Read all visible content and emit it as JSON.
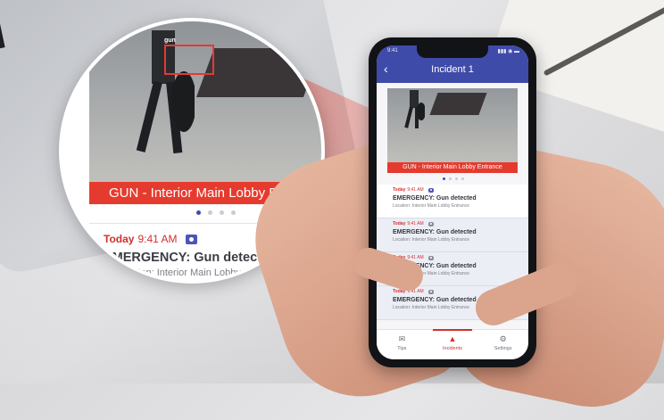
{
  "zoom": {
    "camera_label": "gun",
    "banner": "GUN - Interior Main Lobby Entrance",
    "carousel": {
      "count": 4,
      "active": 0
    },
    "alert": {
      "day": "Today",
      "time": "9:41 AM",
      "title": "EMERGENCY: Gun detected",
      "location": "Location: Interior Main Lobby Entrance"
    }
  },
  "phone": {
    "status_time": "9:41",
    "status_icons": "▮▮▮ ◉ ▬",
    "back_icon": "‹",
    "title": "Incident 1",
    "banner": "GUN - Interior Main Lobby Entrance",
    "carousel": {
      "count": 4,
      "active": 0
    },
    "alerts": [
      {
        "day": "Today",
        "time": "9:41 AM",
        "title": "EMERGENCY: Gun detected",
        "location": "Location: Interior Main Lobby Entrance",
        "icon": "camera-icon"
      },
      {
        "day": "Today",
        "time": "9:41 AM",
        "title": "EMERGENCY: Gun detected",
        "location": "Location: Interior Main Lobby Entrance",
        "icon": "camera-icon"
      },
      {
        "day": "Today",
        "time": "9:41 AM",
        "title": "EMERGENCY: Gun detected",
        "location": "Location: Interior Main Lobby Entrance",
        "icon": "camera-icon"
      },
      {
        "day": "Today",
        "time": "9:41 AM",
        "title": "EMERGENCY: Gun detected",
        "location": "Location: Interior Main Lobby Entrance",
        "icon": "camera-icon"
      }
    ],
    "tabs": [
      {
        "label": "Tips",
        "icon": "✉",
        "icon_name": "tips-icon"
      },
      {
        "label": "Incidents",
        "icon": "▲",
        "icon_name": "bell-icon"
      },
      {
        "label": "Settings",
        "icon": "⚙",
        "icon_name": "gear-icon"
      }
    ],
    "active_tab": 1
  },
  "colors": {
    "accent": "#3f4ba8",
    "alert": "#e53b2e",
    "today": "#d32f2f"
  }
}
